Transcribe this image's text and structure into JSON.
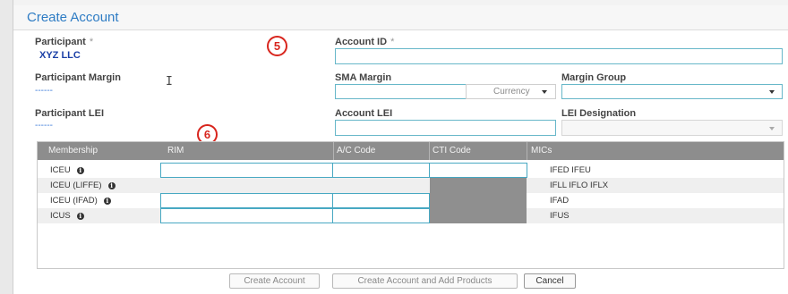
{
  "dialog": {
    "title": "Create Account"
  },
  "form": {
    "participant": {
      "label": "Participant",
      "required_mark": "*",
      "value": "XYZ LLC"
    },
    "account_id": {
      "label": "Account ID",
      "required_mark": "*",
      "value": ""
    },
    "participant_margin": {
      "label": "Participant Margin",
      "value": "------"
    },
    "sma_margin": {
      "label": "SMA Margin",
      "value": "",
      "currency_placeholder": "Currency"
    },
    "margin_group": {
      "label": "Margin Group",
      "value": ""
    },
    "participant_lei": {
      "label": "Participant LEI",
      "value": "------"
    },
    "account_lei": {
      "label": "Account LEI",
      "value": ""
    },
    "lei_designation": {
      "label": "LEI Designation",
      "value": ""
    }
  },
  "markers": {
    "five": "5",
    "six": "6"
  },
  "memberships": {
    "columns": [
      "Membership",
      "RIM",
      "A/C Code",
      "CTI Code",
      "MICs"
    ],
    "rows": [
      {
        "membership": "ICEU",
        "info": "i",
        "mics": "IFED IFEU",
        "inputs": true,
        "cti_disabled": false
      },
      {
        "membership": "ICEU (LIFFE)",
        "info": "i",
        "mics": "IFLL IFLO IFLX",
        "inputs": false,
        "cti_disabled": true
      },
      {
        "membership": "ICEU (IFAD)",
        "info": "i",
        "mics": "IFAD",
        "inputs": true,
        "cti_disabled": true
      },
      {
        "membership": "ICUS",
        "info": "i",
        "mics": "IFUS",
        "inputs": true,
        "cti_disabled": true
      }
    ]
  },
  "buttons": {
    "create_account": "Create Account",
    "create_and_add": "Create Account and Add Products",
    "cancel": "Cancel"
  }
}
